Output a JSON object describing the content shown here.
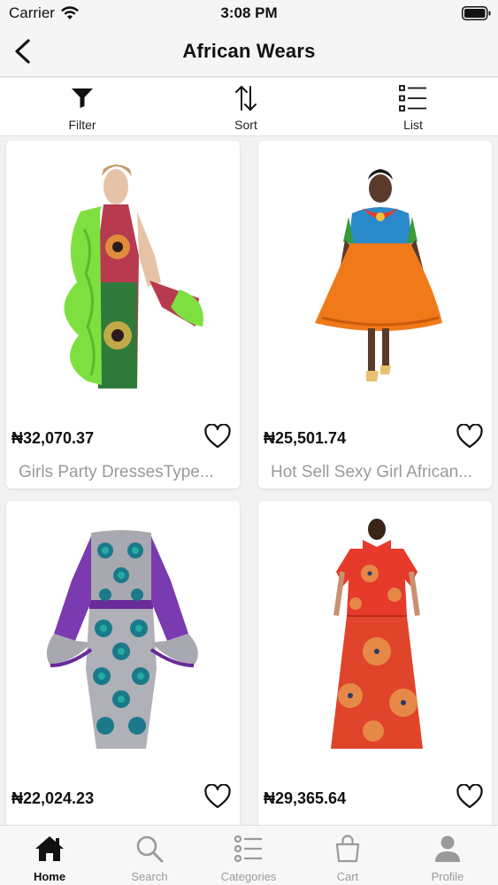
{
  "status_bar": {
    "carrier": "Carrier",
    "time": "3:08 PM"
  },
  "nav": {
    "title": "African Wears"
  },
  "toolbar": {
    "filter_label": "Filter",
    "sort_label": "Sort",
    "list_label": "List"
  },
  "products": [
    {
      "price": "₦32,070.37",
      "name": "Girls Party DressesType..."
    },
    {
      "price": "₦25,501.74",
      "name": "Hot Sell Sexy Girl African..."
    },
    {
      "price": "₦22,024.23",
      "name": ""
    },
    {
      "price": "₦29,365.64",
      "name": ""
    }
  ],
  "tabs": [
    {
      "label": "Home",
      "icon": "home-icon",
      "active": true
    },
    {
      "label": "Search",
      "icon": "search-icon",
      "active": false
    },
    {
      "label": "Categories",
      "icon": "list-icon",
      "active": false
    },
    {
      "label": "Cart",
      "icon": "cart-icon",
      "active": false
    },
    {
      "label": "Profile",
      "icon": "person-icon",
      "active": false
    }
  ],
  "colors": {
    "active_tab": "#111111",
    "inactive_tab": "#9a9a9a",
    "price": "#111111",
    "product_name": "#9a9a9a"
  }
}
